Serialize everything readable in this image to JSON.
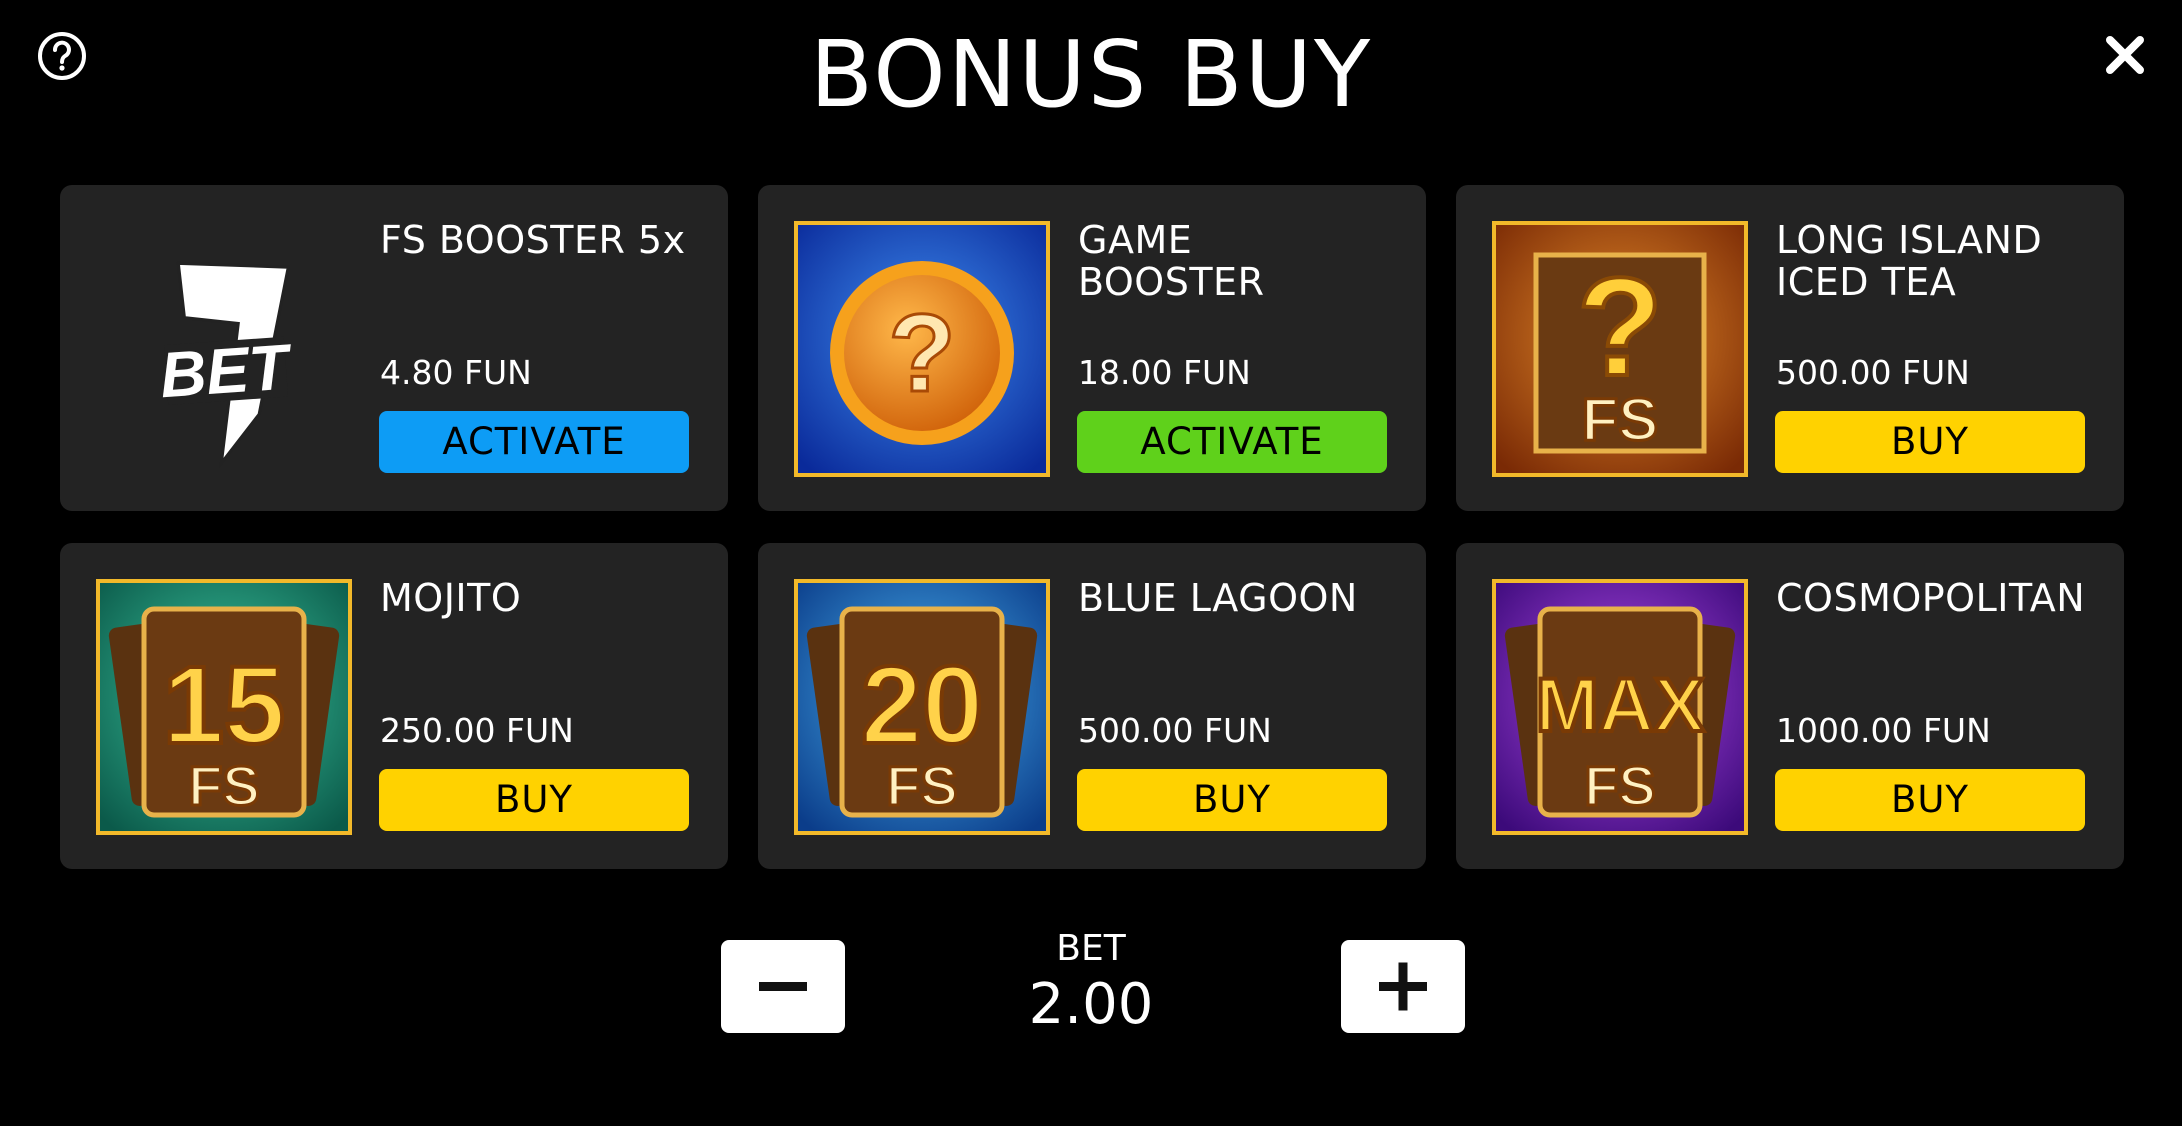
{
  "header": {
    "title": "BONUS BUY",
    "help_icon": "question-circle-icon",
    "close_icon": "close-icon"
  },
  "cards": [
    {
      "name": "FS BOOSTER 5x",
      "price": "4.80 FUN",
      "button": "ACTIVATE",
      "button_color": "#0d9cf5",
      "art": "7bet-logo"
    },
    {
      "name": "GAME BOOSTER",
      "price": "18.00 FUN",
      "button": "ACTIVATE",
      "button_color": "#5fd11b",
      "art": "mystery-coin"
    },
    {
      "name": "LONG ISLAND ICED TEA",
      "price": "500.00 FUN",
      "button": "BUY",
      "button_color": "#ffd200",
      "art": "mystery-fs"
    },
    {
      "name": "MOJITO",
      "price": "250.00 FUN",
      "button": "BUY",
      "button_color": "#ffd200",
      "art": "fs-15",
      "art_text": "15",
      "art_sub": "FS"
    },
    {
      "name": "BLUE LAGOON",
      "price": "500.00 FUN",
      "button": "BUY",
      "button_color": "#ffd200",
      "art": "fs-20",
      "art_text": "20",
      "art_sub": "FS"
    },
    {
      "name": "COSMOPOLITAN",
      "price": "1000.00 FUN",
      "button": "BUY",
      "button_color": "#ffd200",
      "art": "fs-max",
      "art_text": "MAX",
      "art_sub": "FS"
    }
  ],
  "bet": {
    "label": "BET",
    "value": "2.00"
  },
  "colors": {
    "background": "#000000",
    "card": "#232323",
    "frame": "#f2b92a"
  }
}
